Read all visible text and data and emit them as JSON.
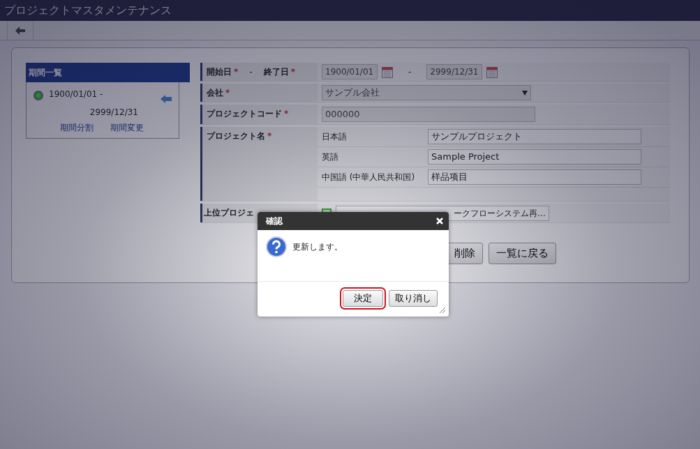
{
  "window": {
    "title": "プロジェクトマスタメンテナンス"
  },
  "required_mark": "*",
  "period_list": {
    "title": "期間一覧",
    "items": [
      {
        "start": "1900/01/01 -",
        "end": "2999/12/31",
        "active": true,
        "selected": true
      }
    ],
    "links": [
      "期間分割",
      "期間変更"
    ]
  },
  "form": {
    "rows": [
      {
        "kind": "daterange",
        "label": "開始日",
        "required": true,
        "separator": "-",
        "label2": "終了日",
        "required2": true,
        "start": "1900/01/01",
        "range_separator": "-",
        "end": "2999/12/31",
        "disabled": true
      },
      {
        "kind": "select",
        "label": "会社",
        "required": true,
        "value": "サンプル会社",
        "disabled": true
      },
      {
        "kind": "text",
        "label": "プロジェクトコード",
        "required": true,
        "value": "000000",
        "disabled": true
      },
      {
        "kind": "multilang",
        "label": "プロジェクト名",
        "required": true,
        "langs": [
          {
            "lang": "日本語",
            "value": "サンプルプロジェクト"
          },
          {
            "lang": "英語",
            "value": "Sample Project"
          },
          {
            "lang": "中国語 (中華人民共和国)",
            "value": "样品项目"
          }
        ]
      },
      {
        "kind": "picker",
        "label": "上位プロジェ",
        "required": false,
        "value": "ークフローシステム再…"
      }
    ]
  },
  "buttons": [
    {
      "label": "削除"
    },
    {
      "label": "一覧に戻る"
    }
  ],
  "dialog": {
    "title": "確認",
    "message": "更新します。",
    "buttons": [
      {
        "label": "決定",
        "focused": true
      },
      {
        "label": "取り消し",
        "focused": false
      }
    ]
  }
}
